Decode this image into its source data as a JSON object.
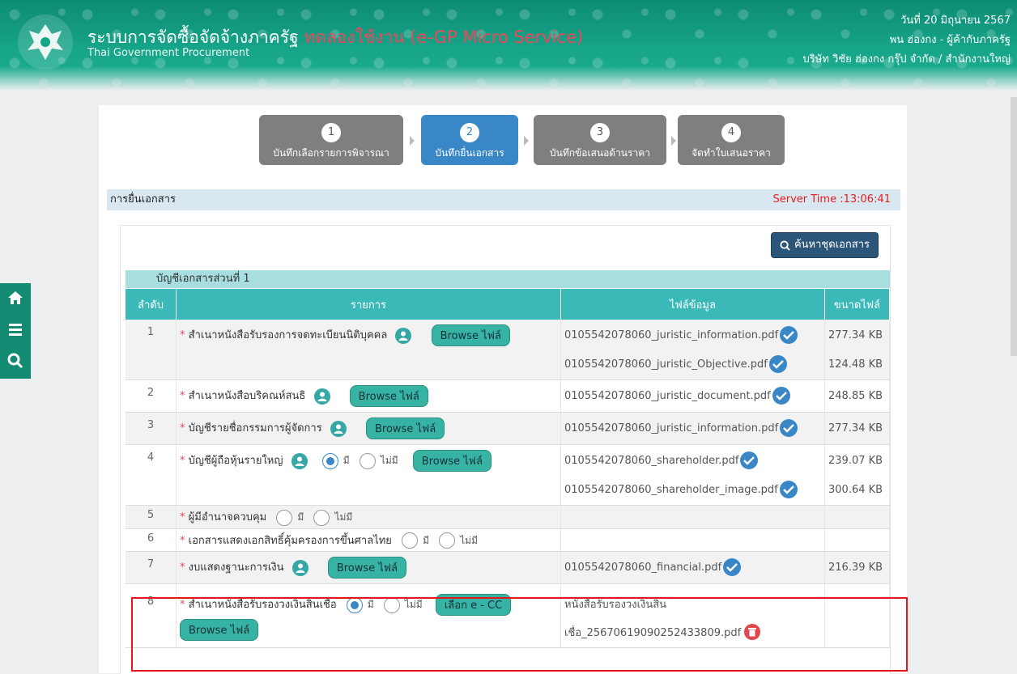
{
  "header": {
    "title": "ระบบการจัดซื้อจัดจ้างภาครัฐ",
    "trial": "ทดลองใช้งาน (e-GP Micro Service)",
    "subtitle": "Thai Government Procurement",
    "date": "วันที่ 20 มิถุนายน 2567",
    "user": "พน ฮ่องกง - ผู้ค้ากับภาครัฐ",
    "company": "บริษัท วิชัย ฮ่องกง กรุ๊ป จำกัด / สำนักงานใหญ่"
  },
  "sidetools": {
    "icons": [
      "home-icon",
      "menu-icon",
      "search-icon"
    ]
  },
  "steps": [
    {
      "num": "1",
      "label": "บันทึกเลือกรายการพิจารณา",
      "active": false
    },
    {
      "num": "2",
      "label": "บันทึกยื่นเอกสาร",
      "active": true
    },
    {
      "num": "3",
      "label": "บันทึกข้อเสนอด้านราคา",
      "active": false
    },
    {
      "num": "4",
      "label": "จัดทำใบเสนอราคา",
      "active": false
    }
  ],
  "section": {
    "label": "การยื่นเอกสาร",
    "server_time": "Server Time :13:06:41"
  },
  "search_button": "ค้นหาชุดเอกสาร",
  "doc_list_title": "บัญชีเอกสารส่วนที่ 1",
  "table": {
    "headers": {
      "no": "ลำดับ",
      "item": "รายการ",
      "file": "ไฟล์ข้อมูล",
      "size": "ขนาดไฟล์"
    },
    "browse_label": "Browse ไฟล์",
    "ecc_label": "เลือก e - CC",
    "yes_label": "มี",
    "no_label": "ไม่มี",
    "rows": [
      {
        "no": "1",
        "item": "สำเนาหนังสือรับรองการจดทะเบียนนิติบุคคล",
        "files": [
          {
            "name": "0105542078060_juristic_information.pdf",
            "size": "277.34 KB"
          },
          {
            "name": "0105542078060_juristic_Objective.pdf",
            "size": "124.48 KB"
          }
        ]
      },
      {
        "no": "2",
        "item": "สำเนาหนังสือบริคณห์สนธิ",
        "files": [
          {
            "name": "0105542078060_juristic_document.pdf",
            "size": "248.85 KB"
          }
        ]
      },
      {
        "no": "3",
        "item": "บัญชีรายชื่อกรรมการผู้จัดการ",
        "files": [
          {
            "name": "0105542078060_juristic_information.pdf",
            "size": "277.34 KB"
          }
        ]
      },
      {
        "no": "4",
        "item": "บัญชีผู้ถือหุ้นรายใหญ่",
        "files": [
          {
            "name": "0105542078060_shareholder.pdf",
            "size": "239.07 KB"
          },
          {
            "name": "0105542078060_shareholder_image.pdf",
            "size": "300.64 KB"
          }
        ]
      },
      {
        "no": "5",
        "item": "ผู้มีอำนาจควบคุม"
      },
      {
        "no": "6",
        "item": "เอกสารแสดงเอกสิทธิ์คุ้มครองการขึ้นศาลไทย"
      },
      {
        "no": "7",
        "item": "งบแสดงฐานะการเงิน",
        "files": [
          {
            "name": "0105542078060_financial.pdf",
            "size": "216.39 KB"
          }
        ]
      },
      {
        "no": "8",
        "item": "สำเนาหนังสือรับรองวงเงินสินเชื่อ",
        "file_line1": "หนังสือรับรองวงเงินสิน",
        "file_line2": "เชื่อ_25670619090252433809.pdf"
      }
    ]
  }
}
